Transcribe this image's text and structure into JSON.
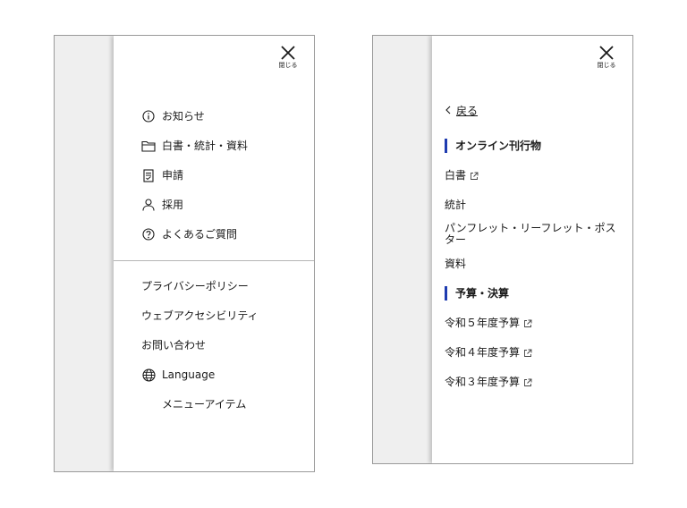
{
  "left_panel": {
    "close_label": "閉じる",
    "menu": [
      {
        "label": "お知らせ",
        "icon": "info-icon"
      },
      {
        "label": "白書・統計・資料",
        "icon": "folder-icon"
      },
      {
        "label": "申請",
        "icon": "document-icon"
      },
      {
        "label": "採用",
        "icon": "person-icon"
      },
      {
        "label": "よくあるご質問",
        "icon": "question-icon"
      }
    ],
    "links": [
      {
        "label": "プライバシーポリシー"
      },
      {
        "label": "ウェブアクセシビリティ"
      },
      {
        "label": "お問い合わせ"
      },
      {
        "label": "Language",
        "icon": "globe-icon"
      },
      {
        "label": "メニューアイテム"
      }
    ]
  },
  "right_panel": {
    "close_label": "閉じる",
    "back_label": "戻る",
    "sections": [
      {
        "heading": "オンライン刊行物",
        "items": [
          {
            "label": "白書",
            "external": true
          },
          {
            "label": "統計",
            "external": false
          },
          {
            "label": "パンフレット・リーフレット・ポスター",
            "external": false
          },
          {
            "label": "資料",
            "external": false
          }
        ]
      },
      {
        "heading": "予算・決算",
        "items": [
          {
            "label": "令和５年度予算",
            "external": true
          },
          {
            "label": "令和４年度予算",
            "external": true
          },
          {
            "label": "令和３年度予算",
            "external": true
          }
        ]
      }
    ]
  },
  "colors": {
    "accent": "#1f3cb0",
    "backdrop": "#efefef",
    "border": "#9a9a9a"
  }
}
